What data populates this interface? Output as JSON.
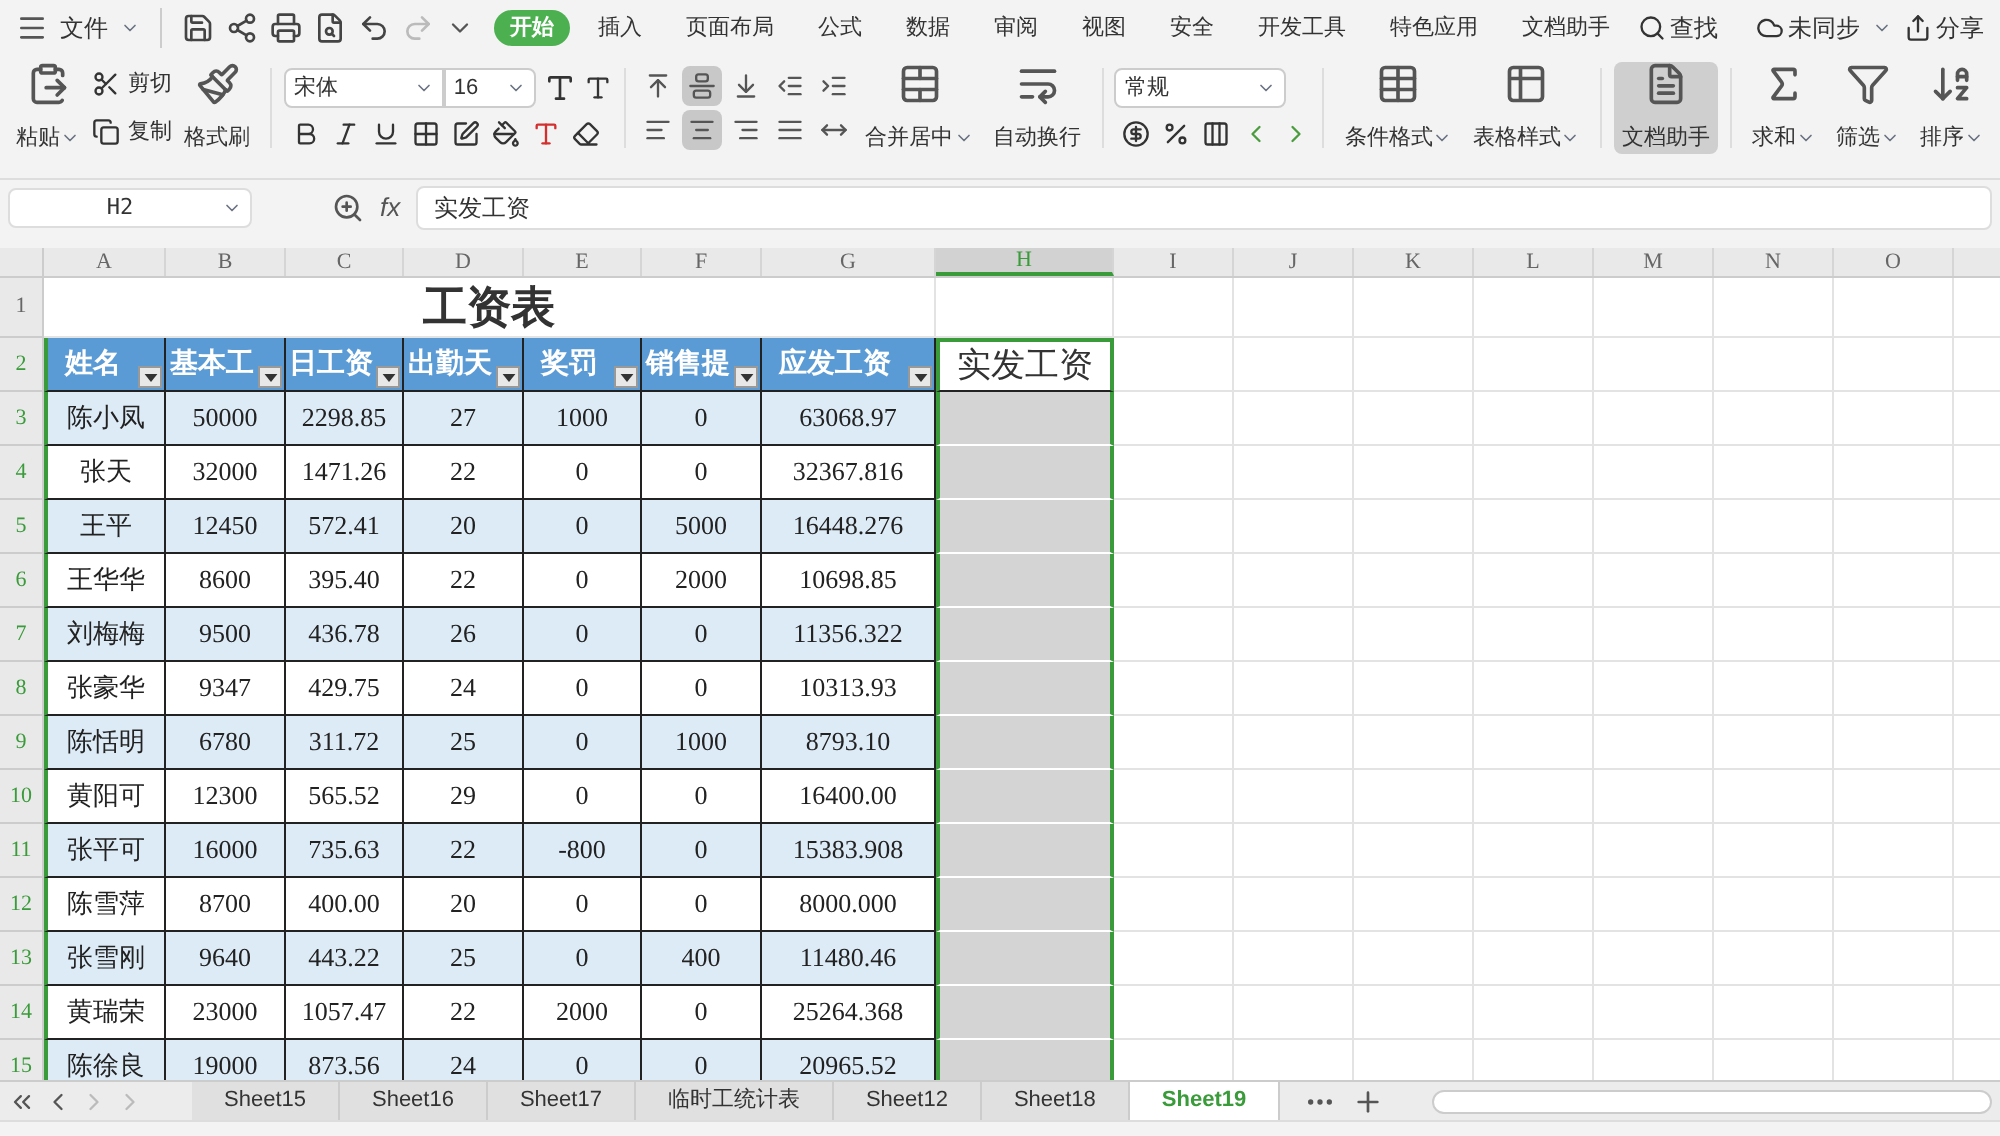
{
  "menu": {
    "file": "文件",
    "tabs": [
      {
        "label": "开始",
        "selected": true
      },
      {
        "label": "插入",
        "selected": false
      },
      {
        "label": "页面布局",
        "selected": false
      },
      {
        "label": "公式",
        "selected": false
      },
      {
        "label": "数据",
        "selected": false
      },
      {
        "label": "审阅",
        "selected": false
      },
      {
        "label": "视图",
        "selected": false
      },
      {
        "label": "安全",
        "selected": false
      },
      {
        "label": "开发工具",
        "selected": false
      },
      {
        "label": "特色应用",
        "selected": false
      },
      {
        "label": "文档助手",
        "selected": false
      }
    ],
    "search": "查找",
    "sync": "未同步",
    "share": "分享"
  },
  "ribbon": {
    "paste": "粘贴",
    "cut": "剪切",
    "copy": "复制",
    "format_painter": "格式刷",
    "font_name": "宋体",
    "font_size": "16",
    "align_buttons": [
      {
        "selected": false
      },
      {
        "selected": true
      },
      {
        "selected": false
      },
      {
        "selected": false
      },
      {
        "selected": false
      },
      {
        "selected": false
      },
      {
        "selected": true
      },
      {
        "selected": false
      },
      {
        "selected": false
      },
      {
        "selected": false
      }
    ],
    "merge": "合并居中",
    "wrap": "自动换行",
    "number_format": "常规",
    "cond_format": "条件格式",
    "table_style": "表格样式",
    "doc_assistant": {
      "label": "文档助手",
      "selected": true
    },
    "sum": "求和",
    "filter": "筛选",
    "sort": "排序"
  },
  "formula_bar": {
    "name_box": "H2",
    "fx": "fx",
    "content": "实发工资"
  },
  "sheet": {
    "columns": [
      {
        "label": "A",
        "selected": false
      },
      {
        "label": "B",
        "selected": false
      },
      {
        "label": "C",
        "selected": false
      },
      {
        "label": "D",
        "selected": false
      },
      {
        "label": "E",
        "selected": false
      },
      {
        "label": "F",
        "selected": false
      },
      {
        "label": "G",
        "selected": false
      },
      {
        "label": "H",
        "selected": true
      },
      {
        "label": "I",
        "selected": false
      },
      {
        "label": "J",
        "selected": false
      },
      {
        "label": "K",
        "selected": false
      },
      {
        "label": "L",
        "selected": false
      },
      {
        "label": "M",
        "selected": false
      },
      {
        "label": "N",
        "selected": false
      },
      {
        "label": "O",
        "selected": false
      }
    ],
    "rows": [
      {
        "number": "1",
        "selected": false
      },
      {
        "number": "2",
        "selected": true
      },
      {
        "number": "3",
        "selected": true
      },
      {
        "number": "4",
        "selected": true
      },
      {
        "number": "5",
        "selected": true
      },
      {
        "number": "6",
        "selected": true
      },
      {
        "number": "7",
        "selected": true
      },
      {
        "number": "8",
        "selected": true
      },
      {
        "number": "9",
        "selected": true
      },
      {
        "number": "10",
        "selected": true
      },
      {
        "number": "11",
        "selected": true
      },
      {
        "number": "12",
        "selected": true
      },
      {
        "number": "13",
        "selected": true
      },
      {
        "number": "14",
        "selected": true
      },
      {
        "number": "15",
        "selected": true
      }
    ],
    "title": "工资表",
    "headers": [
      "姓名",
      "基本工",
      "日工资",
      "出勤天",
      "奖罚",
      "销售提",
      "应发工资",
      "实发工资"
    ],
    "data": [
      [
        "陈小凤",
        "50000",
        "2298.85",
        "27",
        "1000",
        "0",
        "63068.97"
      ],
      [
        "张天",
        "32000",
        "1471.26",
        "22",
        "0",
        "0",
        "32367.816"
      ],
      [
        "王平",
        "12450",
        "572.41",
        "20",
        "0",
        "5000",
        "16448.276"
      ],
      [
        "王华华",
        "8600",
        "395.40",
        "22",
        "0",
        "2000",
        "10698.85"
      ],
      [
        "刘梅梅",
        "9500",
        "436.78",
        "26",
        "0",
        "0",
        "11356.322"
      ],
      [
        "张豪华",
        "9347",
        "429.75",
        "24",
        "0",
        "0",
        "10313.93"
      ],
      [
        "陈恬明",
        "6780",
        "311.72",
        "25",
        "0",
        "1000",
        "8793.10"
      ],
      [
        "黄阳可",
        "12300",
        "565.52",
        "29",
        "0",
        "0",
        "16400.00"
      ],
      [
        "张平可",
        "16000",
        "735.63",
        "22",
        "-800",
        "0",
        "15383.908"
      ],
      [
        "陈雪萍",
        "8700",
        "400.00",
        "20",
        "0",
        "0",
        "8000.000"
      ],
      [
        "张雪刚",
        "9640",
        "443.22",
        "25",
        "0",
        "400",
        "11480.46"
      ],
      [
        "黄瑞荣",
        "23000",
        "1057.47",
        "22",
        "2000",
        "0",
        "25264.368"
      ],
      [
        "陈徐良",
        "19000",
        "873.56",
        "24",
        "0",
        "0",
        "20965.52"
      ]
    ]
  },
  "sheet_tabs": [
    {
      "label": "Sheet15",
      "selected": false
    },
    {
      "label": "Sheet16",
      "selected": false
    },
    {
      "label": "Sheet17",
      "selected": false
    },
    {
      "label": "临时工统计表",
      "selected": false
    },
    {
      "label": "Sheet12",
      "selected": false
    },
    {
      "label": "Sheet18",
      "selected": false
    },
    {
      "label": "Sheet19",
      "selected": true
    }
  ]
}
